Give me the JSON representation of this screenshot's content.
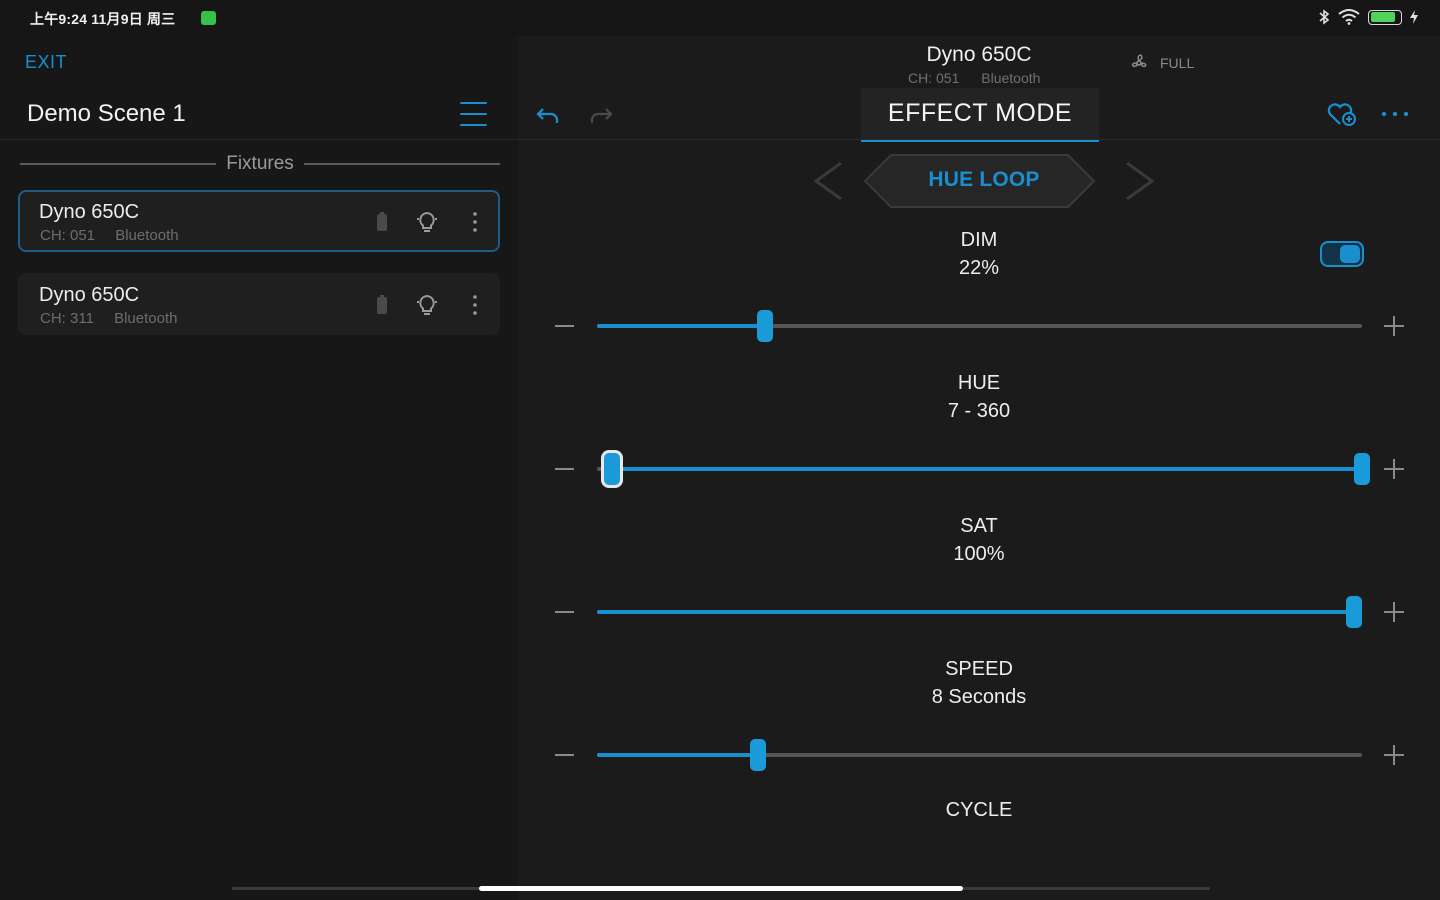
{
  "status": {
    "time_date": "上午9:24 11月9日 周三",
    "battery_level": 0.85,
    "colors": {
      "battery": "#4fd35c",
      "accent": "#1a8fd0"
    }
  },
  "left": {
    "exit_label": "EXIT",
    "scene_title": "Demo Scene 1",
    "fixtures_header": "Fixtures",
    "fixtures": [
      {
        "name": "Dyno 650C",
        "channel": "CH: 051",
        "connection": "Bluetooth",
        "selected": true
      },
      {
        "name": "Dyno 650C",
        "channel": "CH: 311",
        "connection": "Bluetooth",
        "selected": false
      }
    ]
  },
  "device": {
    "name": "Dyno 650C",
    "channel": "CH: 051",
    "connection": "Bluetooth",
    "fan_mode": "FULL"
  },
  "mode_tab": "EFFECT MODE",
  "effect": {
    "name": "HUE LOOP"
  },
  "params": {
    "dim": {
      "label": "DIM",
      "value": "22%",
      "level": 0.22,
      "enabled": true
    },
    "hue": {
      "label": "HUE",
      "value": "7 - 360",
      "min": 7,
      "max": 360,
      "range_max": 360
    },
    "sat": {
      "label": "SAT",
      "value": "100%",
      "level": 1.0
    },
    "speed": {
      "label": "SPEED",
      "value": "8 Seconds",
      "level": 0.21
    },
    "cycle": {
      "label": "CYCLE"
    }
  }
}
